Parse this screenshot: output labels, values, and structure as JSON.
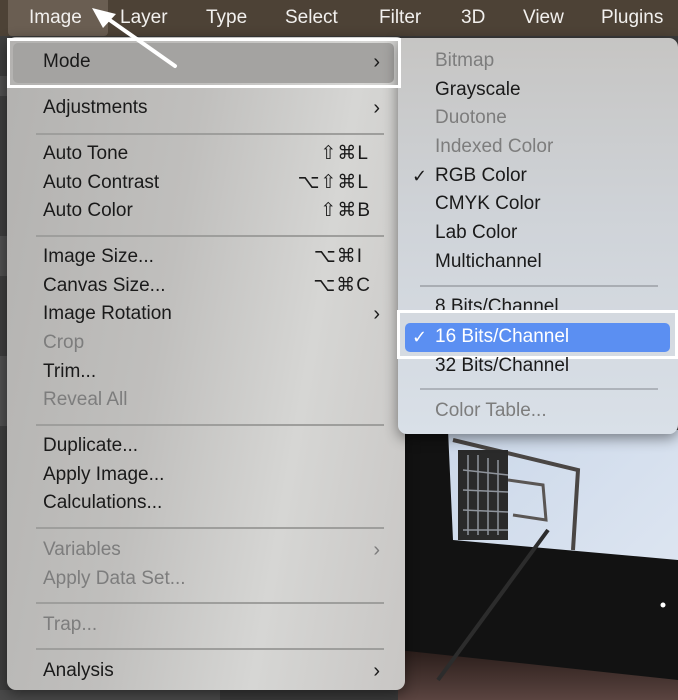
{
  "menubar": {
    "items": [
      "Image",
      "Layer",
      "Type",
      "Select",
      "Filter",
      "3D",
      "View",
      "Plugins"
    ],
    "active": "Image"
  },
  "image_menu": {
    "items": [
      {
        "label": "Mode",
        "submenu": true,
        "enabled": true,
        "highlighted": true
      },
      {
        "label": "Adjustments",
        "submenu": true,
        "enabled": true
      },
      {
        "label": "Auto Tone",
        "shortcut": "⇧⌘L",
        "enabled": true
      },
      {
        "label": "Auto Contrast",
        "shortcut": "⌥⇧⌘L",
        "enabled": true
      },
      {
        "label": "Auto Color",
        "shortcut": "⇧⌘B",
        "enabled": true
      },
      {
        "label": "Image Size...",
        "shortcut": "⌥⌘I",
        "enabled": true
      },
      {
        "label": "Canvas Size...",
        "shortcut": "⌥⌘C",
        "enabled": true
      },
      {
        "label": "Image Rotation",
        "submenu": true,
        "enabled": true
      },
      {
        "label": "Crop",
        "enabled": false
      },
      {
        "label": "Trim...",
        "enabled": true
      },
      {
        "label": "Reveal All",
        "enabled": false
      },
      {
        "label": "Duplicate...",
        "enabled": true
      },
      {
        "label": "Apply Image...",
        "enabled": true
      },
      {
        "label": "Calculations...",
        "enabled": true
      },
      {
        "label": "Variables",
        "submenu": true,
        "enabled": false
      },
      {
        "label": "Apply Data Set...",
        "enabled": false
      },
      {
        "label": "Trap...",
        "enabled": false
      },
      {
        "label": "Analysis",
        "submenu": true,
        "enabled": true
      }
    ],
    "chevron": "›"
  },
  "mode_submenu": {
    "items": [
      {
        "label": "Bitmap",
        "enabled": false
      },
      {
        "label": "Grayscale",
        "enabled": true
      },
      {
        "label": "Duotone",
        "enabled": false
      },
      {
        "label": "Indexed Color",
        "enabled": false
      },
      {
        "label": "RGB Color",
        "enabled": true,
        "checked": true
      },
      {
        "label": "CMYK Color",
        "enabled": true
      },
      {
        "label": "Lab Color",
        "enabled": true
      },
      {
        "label": "Multichannel",
        "enabled": true
      },
      {
        "label": "8 Bits/Channel",
        "enabled": true
      },
      {
        "label": "16 Bits/Channel",
        "enabled": true,
        "checked": true,
        "highlighted": true
      },
      {
        "label": "32 Bits/Channel",
        "enabled": true
      },
      {
        "label": "Color Table...",
        "enabled": false
      }
    ],
    "checkmark": "✓"
  },
  "colors": {
    "menubar_bg": "#4d4236",
    "highlight_blue": "#5b8ff2",
    "callout": "#ffffff"
  }
}
